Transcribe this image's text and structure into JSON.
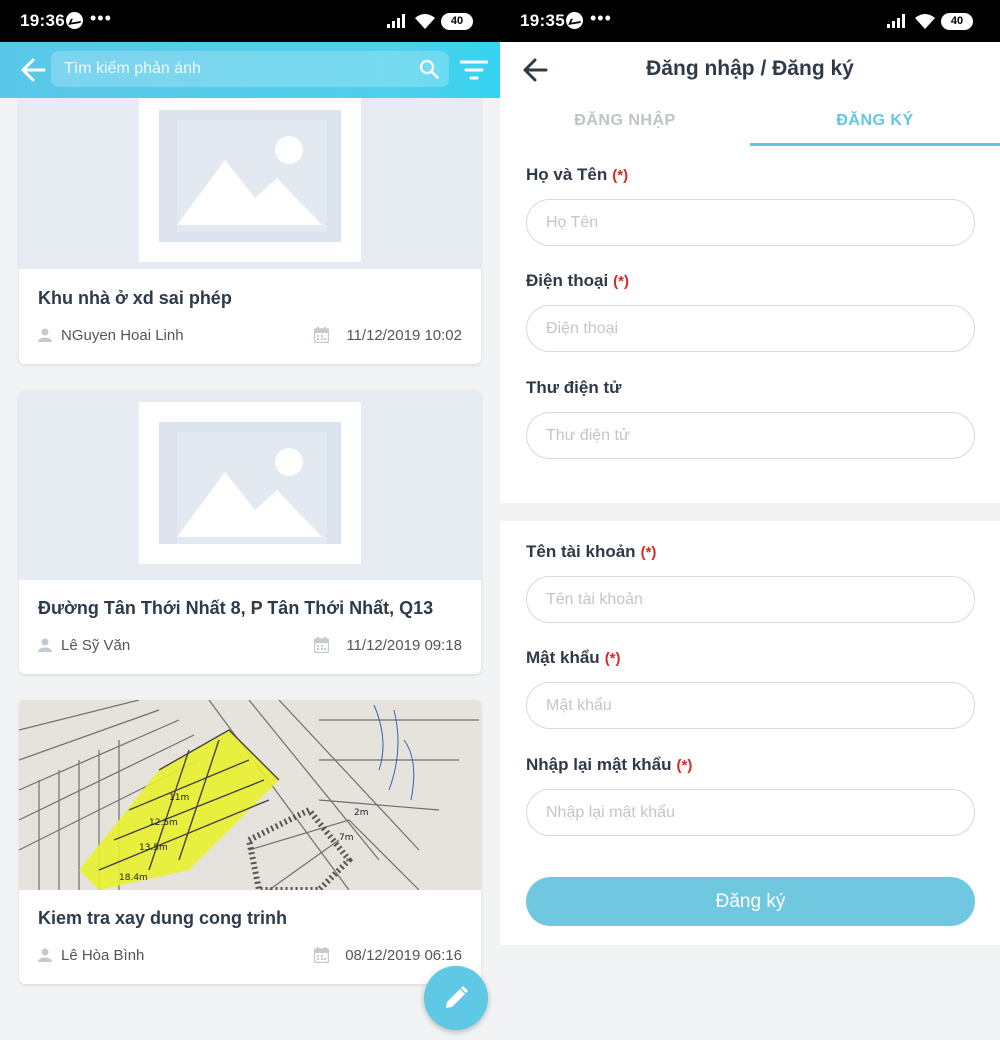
{
  "left": {
    "status": {
      "time": "19:36",
      "battery": "40"
    },
    "search": {
      "placeholder": "Tìm kiếm phản ánh"
    },
    "cards": [
      {
        "title": "Khu nhà ở xd sai phép",
        "author": "NGuyen Hoai Linh",
        "date": "11/12/2019 10:02"
      },
      {
        "title": "Đường Tân Thới Nhất 8, P Tân Thới Nhất, Q13",
        "author": "Lê Sỹ Văn",
        "date": "11/12/2019 09:18"
      },
      {
        "title": "Kiem tra xay dung cong trinh",
        "author": "Lê Hòa Bình",
        "date": "08/12/2019 06:16"
      }
    ]
  },
  "right": {
    "status": {
      "time": "19:35",
      "battery": "40"
    },
    "title": "Đăng nhập / Đăng ký",
    "tabs": {
      "login": "ĐĂNG NHẬP",
      "register": "ĐĂNG KÝ"
    },
    "required_mark": "(*)",
    "fields": {
      "fullname": {
        "label": "Họ và Tên",
        "placeholder": "Họ Tên"
      },
      "phone": {
        "label": "Điện thoại",
        "placeholder": "Điện thoại"
      },
      "email": {
        "label": "Thư điện tử",
        "placeholder": "Thư điện tử"
      },
      "username": {
        "label": "Tên tài khoản",
        "placeholder": "Tên tài khoản"
      },
      "password": {
        "label": "Mật khẩu",
        "placeholder": "Mật khẩu"
      },
      "confirm": {
        "label": "Nhập lại mật khẩu",
        "placeholder": "Nhập lại mật khẩu"
      }
    },
    "submit_label": "Đăng ký"
  },
  "colors": {
    "accent": "#5ec8e5",
    "required": "#e02424",
    "header_gradient_start": "#5bc7e8"
  },
  "icons": [
    "messenger-icon",
    "more-icon",
    "signal-icon",
    "wifi-icon",
    "battery-icon",
    "back-arrow-icon",
    "search-icon",
    "filter-icon",
    "image-placeholder-icon",
    "user-icon",
    "calendar-icon",
    "edit-pencil-icon"
  ]
}
